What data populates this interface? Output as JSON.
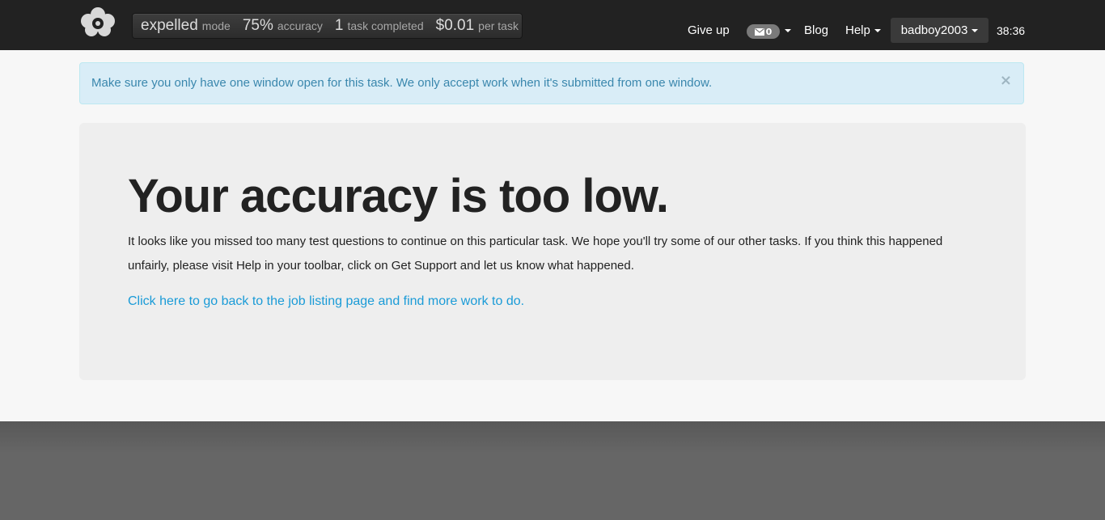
{
  "stats": {
    "mode_value": "expelled",
    "mode_label": "mode",
    "accuracy_value": "75%",
    "accuracy_label": "accuracy",
    "tasks_value": "1",
    "tasks_label": "task completed",
    "pay_value": "$0.01",
    "pay_label": "per task"
  },
  "nav": {
    "give_up": "Give up",
    "mail_count": "0",
    "blog": "Blog",
    "help": "Help",
    "username": "badboy2003",
    "timer": "38:36"
  },
  "alert": {
    "message": "Make sure you only have one window open for this task. We only accept work when it's submitted from one window.",
    "close": "×"
  },
  "hero": {
    "title": "Your accuracy is too low.",
    "description": "It looks like you missed too many test questions to continue on this particular task. We hope you'll try some of our other tasks. If you think this happened unfairly, please visit Help in your toolbar, click on Get Support and let us know what happened.",
    "link": "Click here to go back to the job listing page and find more work to do."
  },
  "colors": {
    "topbar": "#222222",
    "alert_bg": "#d9edf7",
    "alert_text": "#3a87ad",
    "link": "#1a9bd7",
    "hero_bg": "#eeeeee"
  },
  "icons": {
    "logo": "flower-logo-icon",
    "mail": "envelope-icon",
    "caret": "caret-down-icon"
  }
}
